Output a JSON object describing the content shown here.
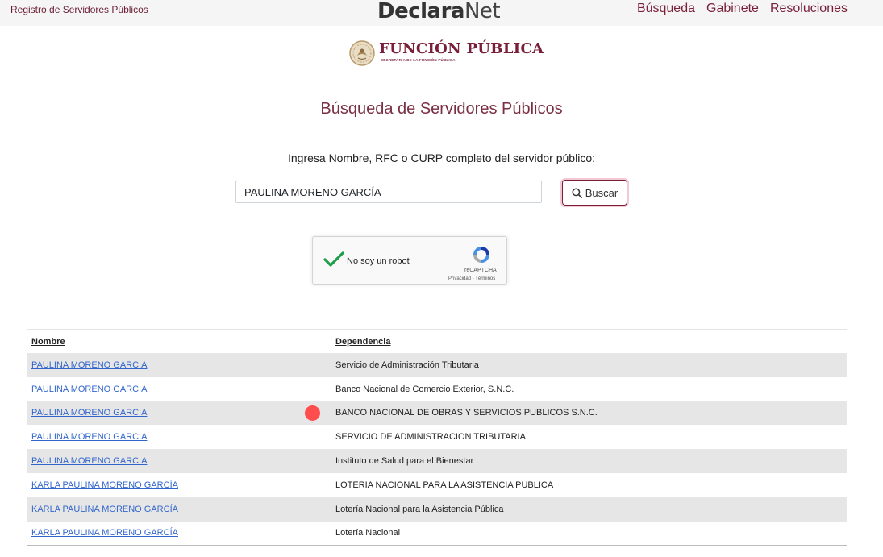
{
  "topbar": {
    "left_label": "Registro de Servidores Públicos",
    "brand_bold": "Declara",
    "brand_light": "Net",
    "nav": [
      "Búsqueda",
      "Gabinete",
      "Resoluciones"
    ]
  },
  "logo": {
    "title": "FUNCIÓN PÚBLICA",
    "subtitle": "SECRETARÍA DE LA FUNCIÓN PÚBLICA"
  },
  "search": {
    "page_title": "Búsqueda de Servidores Públicos",
    "prompt": "Ingresa Nombre, RFC o CURP completo del servidor público:",
    "value": "PAULINA MORENO GARCÍA",
    "button_label": "Buscar"
  },
  "captcha": {
    "label": "No soy un robot",
    "brand": "reCAPTCHA",
    "links": "Privacidad - Términos",
    "checked": true
  },
  "results": {
    "headers": [
      "Nombre",
      "Dependencia"
    ],
    "rows": [
      {
        "nombre": "PAULINA MORENO GARCIA",
        "dependencia": "Servicio de Administración Tributaria"
      },
      {
        "nombre": "PAULINA MORENO GARCIA",
        "dependencia": "Banco Nacional de Comercio Exterior, S.N.C."
      },
      {
        "nombre": "PAULINA MORENO GARCIA",
        "dependencia": "BANCO NACIONAL DE OBRAS Y SERVICIOS PUBLICOS S.N.C."
      },
      {
        "nombre": "PAULINA MORENO GARCIA",
        "dependencia": "SERVICIO DE ADMINISTRACION TRIBUTARIA"
      },
      {
        "nombre": "PAULINA MORENO GARCIA",
        "dependencia": "Instituto de Salud para el Bienestar"
      },
      {
        "nombre": "KARLA PAULINA MORENO GARCÍA",
        "dependencia": "LOTERIA NACIONAL PARA LA ASISTENCIA PUBLICA"
      },
      {
        "nombre": "KARLA PAULINA MORENO GARCÍA",
        "dependencia": "Lotería Nacional para la Asistencia Pública"
      },
      {
        "nombre": "KARLA PAULINA MORENO GARCÍA",
        "dependencia": "Lotería Nacional"
      }
    ]
  },
  "colors": {
    "brand": "#7a1f3a",
    "link": "#3366cc",
    "row_alt": "#e6e6e6",
    "cursor_marker": "#ff4d4d"
  },
  "icons": [
    "search-icon",
    "check-icon",
    "recaptcha-icon",
    "seal-icon"
  ]
}
